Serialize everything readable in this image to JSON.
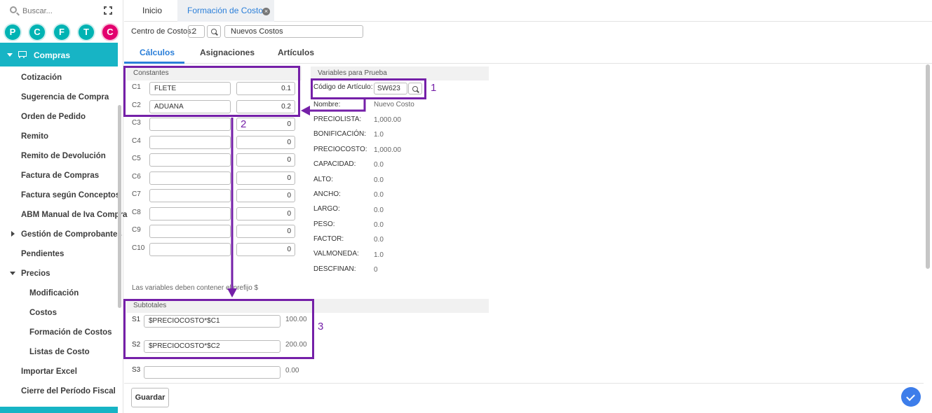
{
  "search": {
    "placeholder": "Buscar..."
  },
  "shortcuts": [
    "P",
    "C",
    "F",
    "T",
    "C"
  ],
  "sidebar": {
    "section": "Compras",
    "items": [
      {
        "label": "Cotización"
      },
      {
        "label": "Sugerencia de Compra"
      },
      {
        "label": "Orden de Pedido"
      },
      {
        "label": "Remito"
      },
      {
        "label": "Remito de Devolución"
      },
      {
        "label": "Factura de Compras"
      },
      {
        "label": "Factura según Conceptos"
      },
      {
        "label": "ABM Manual de Iva Compra"
      },
      {
        "label": "Gestión de Comprobantes"
      },
      {
        "label": "Pendientes"
      },
      {
        "label": "Precios"
      },
      {
        "label": "Modificación"
      },
      {
        "label": "Costos"
      },
      {
        "label": "Formación de Costos"
      },
      {
        "label": "Listas de Costo"
      },
      {
        "label": "Importar Excel"
      },
      {
        "label": "Cierre del Período Fiscal"
      }
    ]
  },
  "tabs": {
    "inicio": "Inicio",
    "formacion": "Formación de Costos"
  },
  "centro": {
    "label": "Centro de Costos:",
    "code": "2",
    "name": "Nuevos Costos"
  },
  "subtabs": [
    "Cálculos",
    "Asignaciones",
    "Artículos"
  ],
  "constantes": {
    "title": "Constantes",
    "rows": [
      {
        "label": "C1",
        "name": "FLETE",
        "value": "0.1"
      },
      {
        "label": "C2",
        "name": "ADUANA",
        "value": "0.2"
      },
      {
        "label": "C3",
        "name": "",
        "value": "0"
      },
      {
        "label": "C4",
        "name": "",
        "value": "0"
      },
      {
        "label": "C5",
        "name": "",
        "value": "0"
      },
      {
        "label": "C6",
        "name": "",
        "value": "0"
      },
      {
        "label": "C7",
        "name": "",
        "value": "0"
      },
      {
        "label": "C8",
        "name": "",
        "value": "0"
      },
      {
        "label": "C9",
        "name": "",
        "value": "0"
      },
      {
        "label": "C10",
        "name": "",
        "value": "0"
      }
    ]
  },
  "variables": {
    "title": "Variables para Prueba",
    "articulo_label": "Código de Artículo:",
    "articulo_code": "SW623",
    "rows": [
      {
        "label": "Nombre:",
        "value": "Nuevo Costo"
      },
      {
        "label": "PRECIOLISTA:",
        "value": "1,000.00"
      },
      {
        "label": "BONIFICACIÓN:",
        "value": "1.0"
      },
      {
        "label": "PRECIOCOSTO:",
        "value": "1,000.00"
      },
      {
        "label": "CAPACIDAD:",
        "value": "0.0"
      },
      {
        "label": "ALTO:",
        "value": "0.0"
      },
      {
        "label": "ANCHO:",
        "value": "0.0"
      },
      {
        "label": "LARGO:",
        "value": "0.0"
      },
      {
        "label": "PESO:",
        "value": "0.0"
      },
      {
        "label": "FACTOR:",
        "value": "0.0"
      },
      {
        "label": "VALMONEDA:",
        "value": "1.0"
      },
      {
        "label": "DESCFINAN:",
        "value": "0"
      }
    ]
  },
  "note": "Las variables deben contener el prefijo $",
  "subtotales": {
    "title": "Subtotales",
    "rows": [
      {
        "label": "S1",
        "expr": "$PRECIOCOSTO*$C1",
        "value": "100.00"
      },
      {
        "label": "S2",
        "expr": "$PRECIOCOSTO*$C2",
        "value": "200.00"
      },
      {
        "label": "S3",
        "expr": "",
        "value": "0.00"
      }
    ]
  },
  "annotations": [
    "1",
    "2",
    "3"
  ],
  "footer": {
    "save_label": "Guardar"
  },
  "colors": {
    "accent": "#17b4c5",
    "tab_active": "#2b7fd9",
    "annotation": "#7520a8",
    "shortcut": "#00b3b3",
    "shortcut_alt": "#e3006e"
  }
}
